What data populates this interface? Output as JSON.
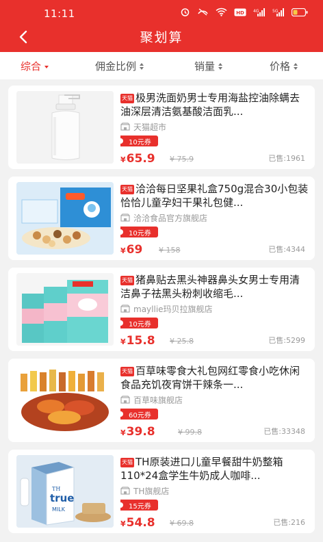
{
  "status_bar": {
    "time": "11:11",
    "battery_icon": "battery-icon",
    "signal_icons": [
      "alarm-icon",
      "wifi-icon",
      "hd-icon",
      "signal-icon"
    ]
  },
  "header": {
    "title": "聚划算",
    "back_icon": "back-arrow-icon"
  },
  "sort_tabs": [
    {
      "label": "综合",
      "active": true
    },
    {
      "label": "佣金比例",
      "active": false
    },
    {
      "label": "销量",
      "active": false
    },
    {
      "label": "价格",
      "active": false
    }
  ],
  "products": [
    {
      "badge": "天猫",
      "title": "极男洗面奶男士专用海盐控油除螨去油深层清洁氨基酸洁面乳...",
      "shop": "天猫超市",
      "coupon": "10元券",
      "price": "65.9",
      "currency": "¥",
      "original_price": "¥ 75.9",
      "sold": "已售:1961"
    },
    {
      "badge": "天猫",
      "title": "洽洽每日坚果礼盒750g混合30小包装恰恰儿童孕妇干果礼包健...",
      "shop": "洽洽食品官方旗舰店",
      "coupon": "10元券",
      "price": "69",
      "currency": "¥",
      "original_price": "¥ 158",
      "sold": "已售:4344"
    },
    {
      "badge": "天猫",
      "title": "猪鼻贴去黑头神器鼻头女男士专用清洁鼻子祛黑头粉刺收缩毛...",
      "shop": "mayllie玛贝拉旗舰店",
      "coupon": "10元券",
      "price": "15.8",
      "currency": "¥",
      "original_price": "¥ 25.8",
      "sold": "已售:5299"
    },
    {
      "badge": "天猫",
      "title": "百草味零食大礼包网红零食小吃休闲食品充饥夜宵饼干辣条一...",
      "shop": "百草味旗舰店",
      "coupon": "60元券",
      "price": "39.8",
      "currency": "¥",
      "original_price": "¥ 99.8",
      "sold": "已售:33348"
    },
    {
      "badge": "天猫",
      "title": "TH原装进口儿童早餐甜牛奶整箱110*24盒学生牛奶成人咖啡...",
      "shop": "TH旗舰店",
      "coupon": "15元券",
      "price": "54.8",
      "currency": "¥",
      "original_price": "¥ 69.8",
      "sold": "已售:216"
    }
  ],
  "thumb_text": {
    "milk_brand_top": "TH",
    "milk_brand": "true",
    "milk_sub": "MILK"
  },
  "colors": {
    "primary": "#e8302c",
    "background": "#f2f2f2"
  }
}
